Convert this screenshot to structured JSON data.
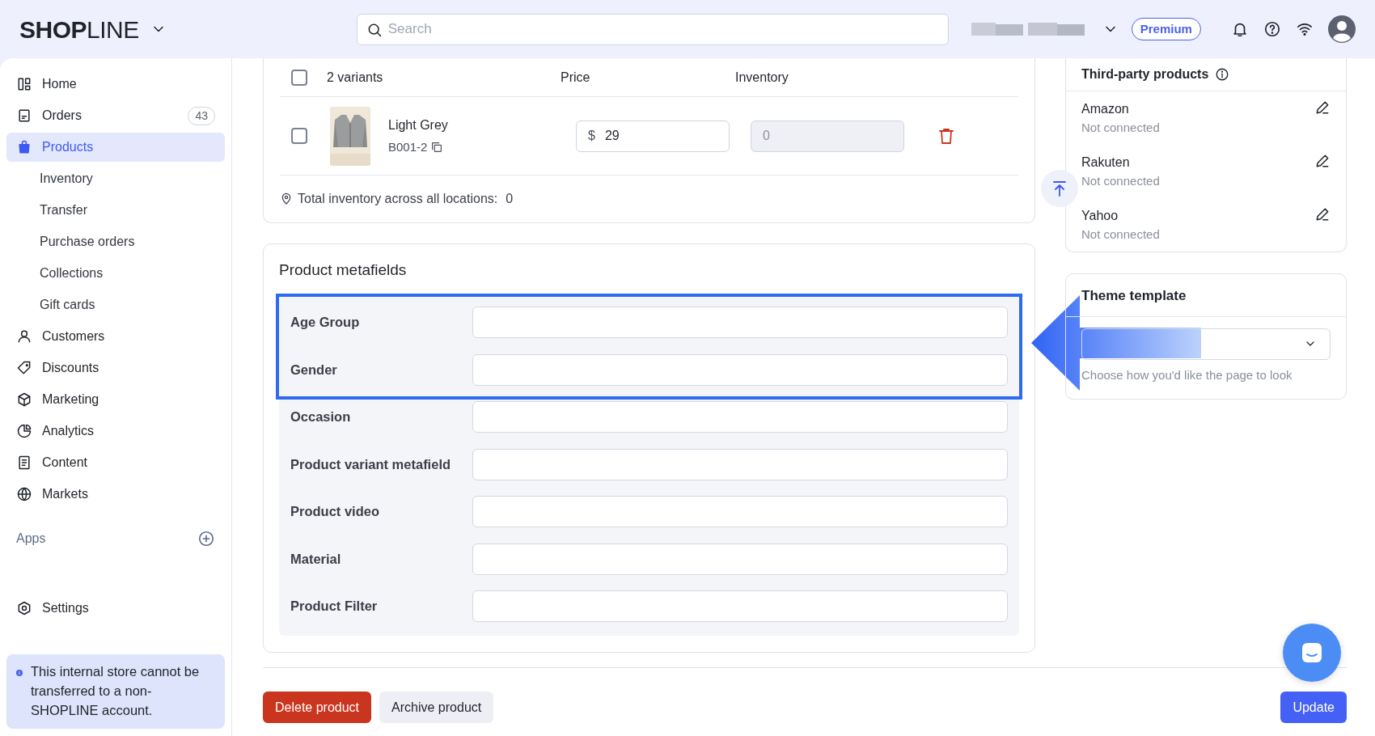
{
  "header": {
    "logo_bold": "SHOP",
    "logo_light": "LINE",
    "search": {
      "placeholder": "Search"
    },
    "plan_badge": "Premium"
  },
  "sidebar": {
    "items": [
      {
        "label": "Home",
        "kind": "main",
        "selected": false
      },
      {
        "label": "Orders",
        "kind": "main",
        "selected": false,
        "badge": "43"
      },
      {
        "label": "Products",
        "kind": "main",
        "selected": true
      },
      {
        "label": "Inventory",
        "kind": "sub",
        "selected": false
      },
      {
        "label": "Transfer",
        "kind": "sub",
        "selected": false
      },
      {
        "label": "Purchase orders",
        "kind": "sub",
        "selected": false
      },
      {
        "label": "Collections",
        "kind": "sub",
        "selected": false
      },
      {
        "label": "Gift cards",
        "kind": "sub",
        "selected": false
      },
      {
        "label": "Customers",
        "kind": "main",
        "selected": false
      },
      {
        "label": "Discounts",
        "kind": "main",
        "selected": false
      },
      {
        "label": "Marketing",
        "kind": "main",
        "selected": false
      },
      {
        "label": "Analytics",
        "kind": "main",
        "selected": false
      },
      {
        "label": "Content",
        "kind": "main",
        "selected": false
      },
      {
        "label": "Markets",
        "kind": "main",
        "selected": false
      }
    ],
    "apps_heading": "Apps",
    "footer_items": [
      {
        "label": "Settings",
        "selected": false
      }
    ],
    "notice": "This internal store cannot be transferred to a non-SHOPLINE account."
  },
  "variants": {
    "count_label": "2 variants",
    "header_checked": false,
    "columns": [
      "Price",
      "Inventory"
    ],
    "rows": [
      {
        "name": "Light Grey",
        "sku": "B001-2",
        "currency": "$",
        "price": "29",
        "inventory": "0",
        "checked": false,
        "inventory_disabled": true
      }
    ],
    "total_label": "Total inventory across all locations:",
    "total_value": "0"
  },
  "metafields": {
    "title": "Product metafields",
    "fields": [
      {
        "label": "Age Group",
        "highlighted": true
      },
      {
        "label": "Gender",
        "highlighted": true
      },
      {
        "label": "Occasion",
        "highlighted": false
      },
      {
        "label": "Product variant metafield",
        "highlighted": false
      },
      {
        "label": "Product video",
        "highlighted": false
      },
      {
        "label": "Material",
        "highlighted": false
      },
      {
        "label": "Product Filter",
        "highlighted": false
      }
    ]
  },
  "third_party": {
    "title": "Third-party products",
    "channels": [
      {
        "name": "Amazon",
        "status": "Not connected"
      },
      {
        "name": "Rakuten",
        "status": "Not connected"
      },
      {
        "name": "Yahoo",
        "status": "Not connected"
      }
    ]
  },
  "theme_template": {
    "title": "Theme template",
    "help": "Choose how you'd like the page to look"
  },
  "actions": {
    "delete": "Delete product",
    "archive": "Archive product",
    "update": "Update"
  },
  "pointer_arrow": true
}
